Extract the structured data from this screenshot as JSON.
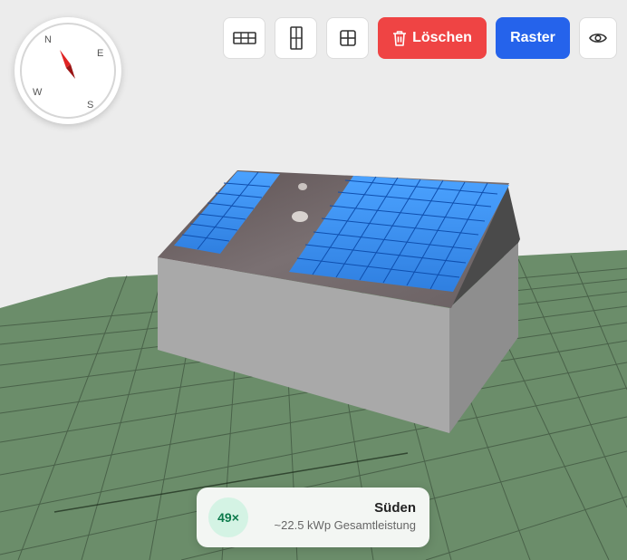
{
  "compass": {
    "north": "N",
    "east": "E",
    "south": "S",
    "west": "W",
    "needle_color": "#e02424"
  },
  "toolbar": {
    "landscape_icon": "panel-landscape-icon",
    "portrait_icon": "panel-portrait-icon",
    "grid_icon": "grid-icon",
    "delete_label": "Löschen",
    "delete_icon": "trash-icon",
    "raster_label": "Raster",
    "view_icon": "eye-icon"
  },
  "status": {
    "count": "49×",
    "direction": "Süden",
    "power": "~22.5 kWp Gesamtleistung"
  },
  "colors": {
    "ground": "#6b8d6a",
    "panel": "#3d8ef2",
    "roof": "#6e6466",
    "wall": "#a9a9a9",
    "danger": "#ef4444",
    "primary": "#2563eb"
  }
}
